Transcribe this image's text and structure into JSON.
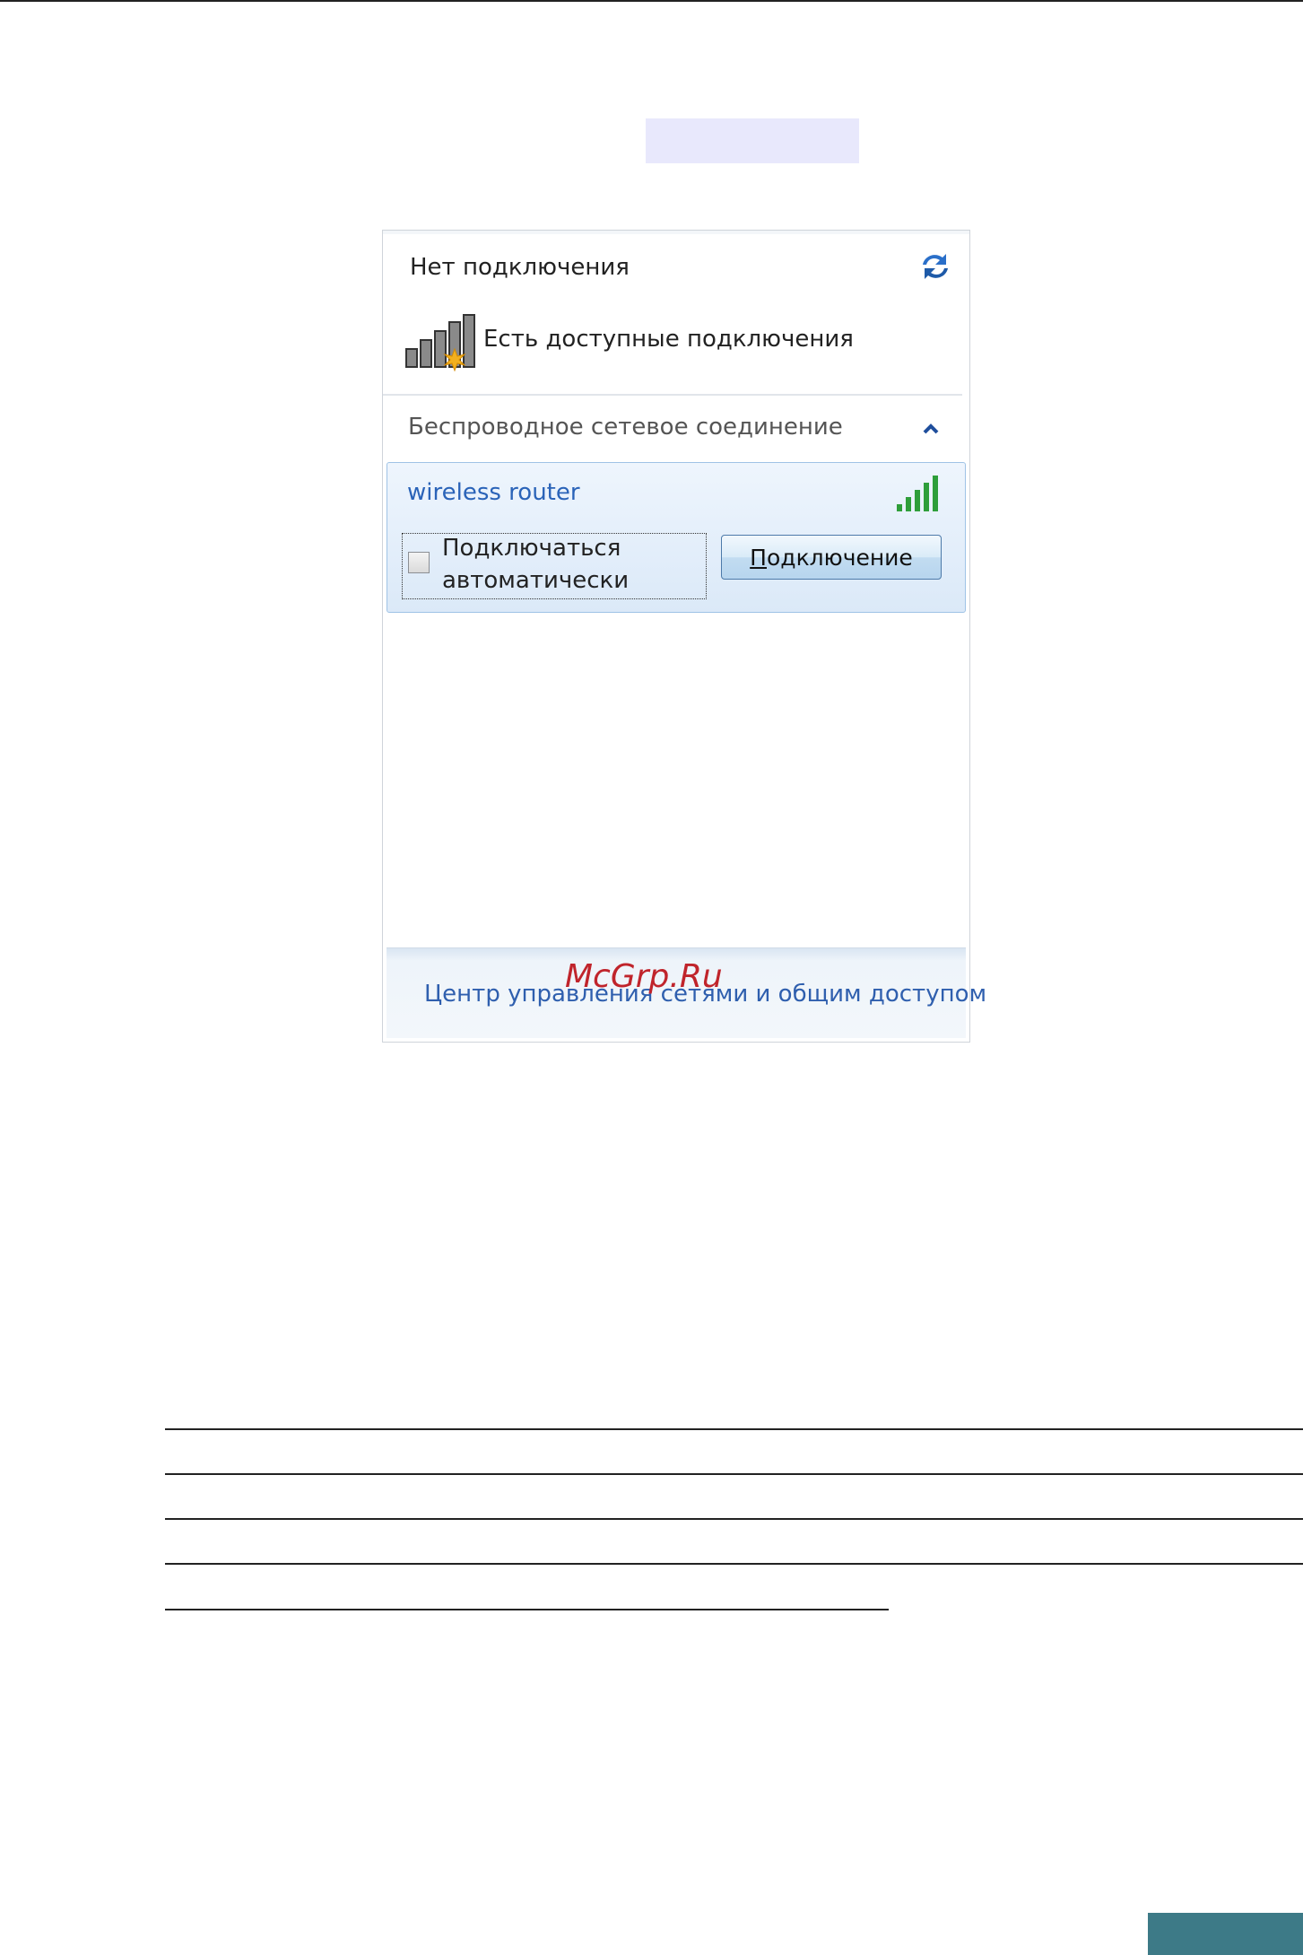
{
  "flyout": {
    "status_title": "Нет подключения",
    "available_text": "Есть доступные подключения",
    "section_title": "Беспроводное сетевое соединение",
    "network": {
      "ssid": "wireless router",
      "auto_connect_line1": "Подключаться",
      "auto_connect_line2": "автоматически",
      "auto_connect_checked": false,
      "connect_button_mnemonic": "П",
      "connect_button_rest": "одключение"
    },
    "footer_link": "Центр управления сетями и общим доступом"
  },
  "watermark": "McGrp.Ru",
  "icons": {
    "refresh": "refresh-icon",
    "no_connection_signal": "signal-available-icon",
    "collapse": "chevron-up-icon",
    "signal_strength": "signal-bars-icon"
  },
  "colors": {
    "link": "#2f5fae",
    "ssid": "#2a63b8",
    "signal_green": "#2e9e3a",
    "star": "#f2b01e",
    "corner_tab": "#3d7a87",
    "watermark": "#c0242b"
  }
}
